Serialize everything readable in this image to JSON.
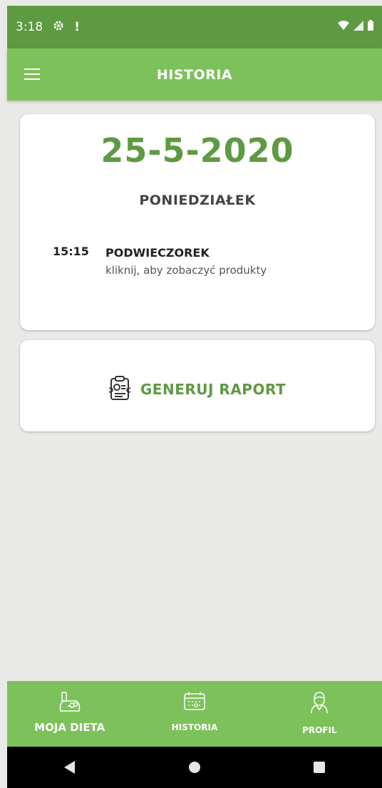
{
  "status_bar": {
    "time": "3:18",
    "notification_icons": [
      "gear-icon",
      "alert-icon"
    ],
    "system_icons": [
      "wifi-icon",
      "signal-icon",
      "battery-icon"
    ]
  },
  "app_bar": {
    "title": "HISTORIA"
  },
  "day_card": {
    "date": "25-5-2020",
    "weekday": "PONIEDZIAŁEK",
    "meals": [
      {
        "time": "15:15",
        "name": "PODWIECZOREK",
        "hint": "kliknij, aby zobaczyć produkty"
      }
    ]
  },
  "report": {
    "label": "GENERUJ RAPORT"
  },
  "bottom_nav": {
    "items": [
      {
        "label": "MOJA DIETA",
        "icon": "diet-icon"
      },
      {
        "label": "HISTORIA",
        "icon": "calendar-icon"
      },
      {
        "label": "PROFIL",
        "icon": "profile-icon"
      }
    ]
  },
  "colors": {
    "primary": "#7dc15a",
    "primary_dark": "#5e9a42",
    "background": "#e9eae8"
  }
}
